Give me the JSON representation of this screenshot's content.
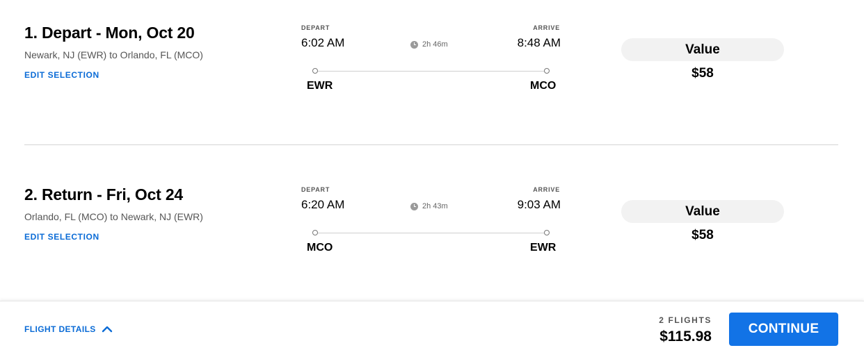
{
  "segments": [
    {
      "title": "1. Depart - Mon, Oct 20",
      "route": "Newark, NJ (EWR) to Orlando, FL (MCO)",
      "edit_label": "EDIT SELECTION",
      "depart_label": "DEPART",
      "arrive_label": "ARRIVE",
      "depart_time": "6:02 AM",
      "arrive_time": "8:48 AM",
      "duration": "2h 46m",
      "origin": "EWR",
      "destination": "MCO",
      "fare_name": "Value",
      "fare_price": "$58"
    },
    {
      "title": "2. Return - Fri, Oct 24",
      "route": "Orlando, FL (MCO) to Newark, NJ (EWR)",
      "edit_label": "EDIT SELECTION",
      "depart_label": "DEPART",
      "arrive_label": "ARRIVE",
      "depart_time": "6:20 AM",
      "arrive_time": "9:03 AM",
      "duration": "2h 43m",
      "origin": "MCO",
      "destination": "EWR",
      "fare_name": "Value",
      "fare_price": "$58"
    }
  ],
  "footer": {
    "flight_details_label": "FLIGHT DETAILS",
    "flight_count": "2 FLIGHTS",
    "total": "$115.98",
    "continue_label": "CONTINUE"
  },
  "icons": {
    "duration": "clock-icon",
    "flight_details_toggle": "chevron-up-icon"
  },
  "colors": {
    "link": "#0a6bd6",
    "primary_button": "#1273e6"
  }
}
